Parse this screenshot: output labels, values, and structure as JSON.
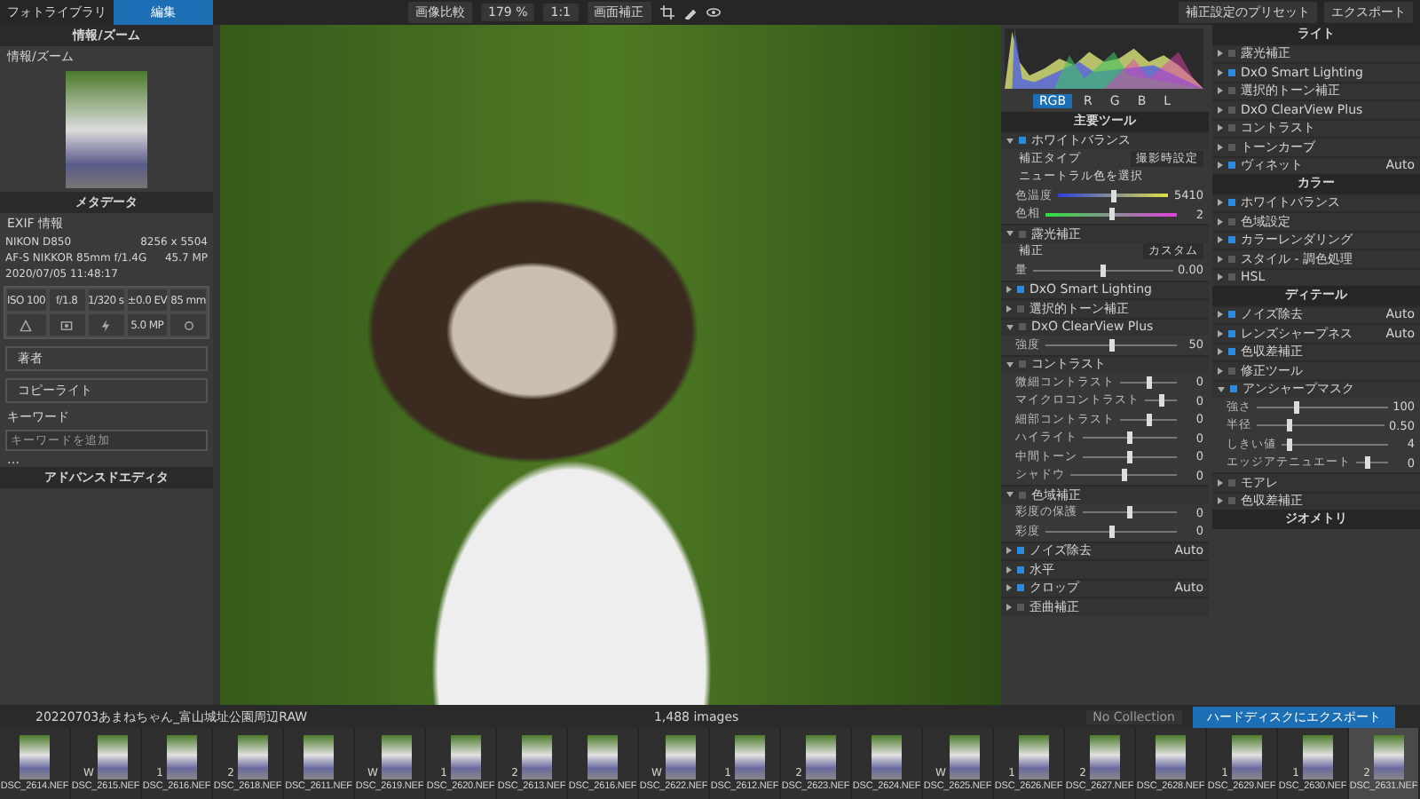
{
  "top_bar": {
    "tabs": [
      {
        "label": "フォトライブラリ",
        "selected": false
      },
      {
        "label": "編集",
        "selected": true
      }
    ],
    "tools": [
      "画像比較",
      "179 %",
      "1:1",
      "画面補正"
    ],
    "right": [
      "補正設定のプリセット",
      "エクスポート"
    ]
  },
  "left_panel": {
    "header": "情報/ズーム",
    "subheader": "情報/ズーム",
    "meta_header": "メタデータ",
    "exif_header": "EXIF 情報",
    "exif_rows": [
      [
        "NIKON D850",
        "8256 x 5504"
      ],
      [
        "AF-S NIKKOR 85mm f/1.4G",
        "45.7 MP"
      ],
      [
        "2020/07/05 11:48:17"
      ]
    ],
    "exposure": [
      "ISO 100",
      "f/1.8",
      "1/320 s",
      "±0.0 EV",
      "85 mm"
    ],
    "flash_reading": "5.0 MP",
    "fields": [
      {
        "label": "著者"
      },
      {
        "label": "コピーライト"
      }
    ],
    "keywords_header": "キーワード",
    "keywords_placeholder": "キーワードを追加",
    "more": "…",
    "footer": "アドバンスドエディタ"
  },
  "right_panel": {
    "channels": [
      {
        "label": "RGB",
        "selected": true
      },
      {
        "label": "R",
        "selected": false
      },
      {
        "label": "G",
        "selected": false
      },
      {
        "label": "B",
        "selected": false
      },
      {
        "label": "L",
        "selected": false
      }
    ],
    "items": [
      {
        "kind": "header",
        "label": "主要ツール"
      },
      {
        "kind": "tool",
        "label": "ホワイトバランス",
        "enabled": true,
        "expanded": true
      },
      {
        "kind": "option",
        "label": "補正タイプ",
        "value": "撮影時設定"
      },
      {
        "kind": "option",
        "label": "ニュートラル色を選択"
      },
      {
        "kind": "temperature",
        "label": "色温度",
        "level": 0.5,
        "reading": "5410"
      },
      {
        "kind": "tint",
        "label": "色相",
        "level": 0.5,
        "reading": "2"
      },
      {
        "kind": "tool",
        "label": "露光補正",
        "enabled": false,
        "expanded": true
      },
      {
        "kind": "option",
        "label": "補正",
        "value": "カスタム"
      },
      {
        "kind": "slider",
        "label": "量",
        "level": 0.5,
        "reading": "0.00"
      },
      {
        "kind": "tool",
        "label": "DxO Smart Lighting",
        "enabled": true,
        "expanded": false
      },
      {
        "kind": "tool",
        "label": "選択的トーン補正",
        "enabled": false,
        "expanded": false
      },
      {
        "kind": "tool",
        "label": "DxO ClearView Plus",
        "enabled": false,
        "expanded": true
      },
      {
        "kind": "slider",
        "label": "強度",
        "level": 0.5,
        "reading": "50"
      },
      {
        "kind": "tool",
        "label": "コントラスト",
        "enabled": false,
        "expanded": true
      },
      {
        "kind": "slider",
        "label": "微細コントラスト",
        "level": 0.5,
        "reading": "0"
      },
      {
        "kind": "slider",
        "label": "マイクロコントラスト",
        "level": 0.5,
        "reading": "0"
      },
      {
        "kind": "slider",
        "label": "細部コントラスト",
        "level": 0.5,
        "reading": "0"
      },
      {
        "kind": "slider",
        "label": "ハイライト",
        "level": 0.5,
        "reading": "0"
      },
      {
        "kind": "slider",
        "label": "中間トーン",
        "level": 0.5,
        "reading": "0"
      },
      {
        "kind": "slider",
        "label": "シャドウ",
        "level": 0.5,
        "reading": "0"
      },
      {
        "kind": "tool",
        "label": "色域補正",
        "enabled": false,
        "expanded": true
      },
      {
        "kind": "slider",
        "label": "彩度の保護",
        "level": 0.5,
        "reading": "0"
      },
      {
        "kind": "slider",
        "label": "彩度",
        "level": 0.5,
        "reading": "0"
      },
      {
        "kind": "tool",
        "label": "ノイズ除去",
        "enabled": true,
        "expanded": false,
        "value": "Auto"
      },
      {
        "kind": "tool",
        "label": "水平",
        "enabled": true,
        "expanded": false
      },
      {
        "kind": "tool",
        "label": "クロップ",
        "enabled": true,
        "expanded": false,
        "value": "Auto"
      },
      {
        "kind": "tool",
        "label": "歪曲補正",
        "enabled": false,
        "expanded": false
      },
      {
        "kind": "header",
        "label": "ライト"
      },
      {
        "kind": "tool",
        "label": "露光補正",
        "enabled": false,
        "expanded": false
      },
      {
        "kind": "tool",
        "label": "DxO Smart Lighting",
        "enabled": true,
        "expanded": false
      },
      {
        "kind": "tool",
        "label": "選択的トーン補正",
        "enabled": false,
        "expanded": false
      },
      {
        "kind": "tool",
        "label": "DxO ClearView Plus",
        "enabled": false,
        "expanded": false
      },
      {
        "kind": "tool",
        "label": "コントラスト",
        "enabled": false,
        "expanded": false
      },
      {
        "kind": "tool",
        "label": "トーンカーブ",
        "enabled": false,
        "expanded": false
      },
      {
        "kind": "tool",
        "label": "ヴィネット",
        "enabled": true,
        "expanded": false,
        "value": "Auto"
      },
      {
        "kind": "header",
        "label": "カラー"
      },
      {
        "kind": "tool",
        "label": "ホワイトバランス",
        "enabled": true,
        "expanded": false
      },
      {
        "kind": "tool",
        "label": "色域設定",
        "enabled": false,
        "expanded": false
      },
      {
        "kind": "tool",
        "label": "カラーレンダリング",
        "enabled": true,
        "expanded": false
      },
      {
        "kind": "tool",
        "label": "スタイル - 調色処理",
        "enabled": false,
        "expanded": false
      },
      {
        "kind": "tool",
        "label": "HSL",
        "enabled": false,
        "expanded": false
      },
      {
        "kind": "header",
        "label": "ディテール"
      },
      {
        "kind": "tool",
        "label": "ノイズ除去",
        "enabled": true,
        "expanded": false,
        "value": "Auto"
      },
      {
        "kind": "tool",
        "label": "レンズシャープネス",
        "enabled": true,
        "expanded": false,
        "value": "Auto"
      },
      {
        "kind": "tool",
        "label": "色収差補正",
        "enabled": true,
        "expanded": false
      },
      {
        "kind": "tool",
        "label": "修正ツール",
        "enabled": false,
        "expanded": false
      },
      {
        "kind": "tool",
        "label": "アンシャープマスク",
        "enabled": true,
        "expanded": true
      },
      {
        "kind": "slider",
        "label": "強さ",
        "level": 0.3,
        "reading": "100"
      },
      {
        "kind": "slider",
        "label": "半径",
        "level": 0.25,
        "reading": "0.50"
      },
      {
        "kind": "slider",
        "label": "しきい値",
        "level": 0.05,
        "reading": "4"
      },
      {
        "kind": "slider",
        "label": "エッジアテニュエート",
        "level": 0.3,
        "reading": "0"
      },
      {
        "kind": "tool",
        "label": "モアレ",
        "enabled": false,
        "expanded": false
      },
      {
        "kind": "tool",
        "label": "色収差補正",
        "enabled": false,
        "expanded": false
      },
      {
        "kind": "header",
        "label": "ジオメトリ"
      }
    ]
  },
  "bottom_bar": {
    "folder": "20220703あまねちゃん_富山城址公園周辺RAW",
    "count": "1,488 images",
    "collection": "No Collection",
    "export": "ハードディスクにエクスポート"
  },
  "filmstrip": [
    {
      "name": "DSC_2614.NEF",
      "selected": false
    },
    {
      "badge": "W",
      "name": "DSC_2615.NEF",
      "selected": false
    },
    {
      "badge": "1",
      "name": "DSC_2616.NEF",
      "selected": false
    },
    {
      "badge": "2",
      "name": "DSC_2618.NEF",
      "selected": false
    },
    {
      "name": "DSC_2611.NEF",
      "selected": false
    },
    {
      "badge": "W",
      "name": "DSC_2619.NEF",
      "selected": false
    },
    {
      "badge": "1",
      "name": "DSC_2620.NEF",
      "selected": false
    },
    {
      "badge": "2",
      "name": "DSC_2613.NEF",
      "selected": false
    },
    {
      "name": "DSC_2616.NEF",
      "selected": false
    },
    {
      "badge": "W",
      "name": "DSC_2622.NEF",
      "selected": false
    },
    {
      "badge": "1",
      "name": "DSC_2612.NEF",
      "selected": false
    },
    {
      "badge": "2",
      "name": "DSC_2623.NEF",
      "selected": false
    },
    {
      "name": "DSC_2624.NEF",
      "selected": false
    },
    {
      "badge": "W",
      "name": "DSC_2625.NEF",
      "selected": false
    },
    {
      "badge": "1",
      "name": "DSC_2626.NEF",
      "selected": false
    },
    {
      "badge": "2",
      "name": "DSC_2627.NEF",
      "selected": false
    },
    {
      "name": "DSC_2628.NEF",
      "selected": false
    },
    {
      "badge": "1",
      "name": "DSC_2629.NEF",
      "selected": false
    },
    {
      "badge": "1",
      "name": "DSC_2630.NEF",
      "selected": false
    },
    {
      "badge": "2",
      "name": "DSC_2631.NEF",
      "selected": true
    }
  ]
}
